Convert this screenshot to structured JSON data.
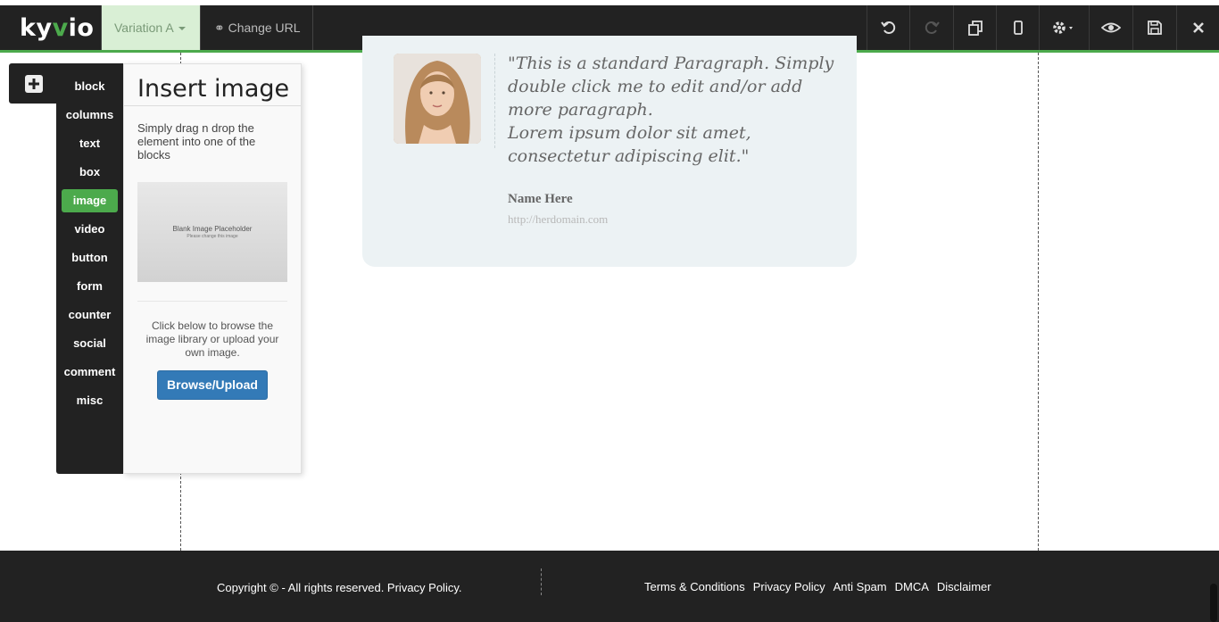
{
  "topbar": {
    "logo_text": "kyvio",
    "variation_label": "Variation A",
    "change_url_label": "Change URL",
    "actions": [
      "undo-icon",
      "redo-icon",
      "duplicate-icon",
      "mobile-preview-icon",
      "settings-icon",
      "preview-icon",
      "save-icon",
      "close-icon"
    ],
    "accent_color": "#4caa4c"
  },
  "sidebar": {
    "items": [
      {
        "label": "block"
      },
      {
        "label": "columns"
      },
      {
        "label": "text"
      },
      {
        "label": "box"
      },
      {
        "label": "image",
        "active": true
      },
      {
        "label": "video"
      },
      {
        "label": "button"
      },
      {
        "label": "form"
      },
      {
        "label": "counter"
      },
      {
        "label": "social"
      },
      {
        "label": "comment"
      },
      {
        "label": "misc"
      }
    ]
  },
  "panel": {
    "title": "Insert image",
    "description": "Simply drag n drop the element into one of the blocks",
    "placeholder_title": "Blank Image Placeholder",
    "placeholder_subtitle": "Please change this image",
    "help_text": "Click below to browse the image library or upload your own image.",
    "browse_label": "Browse/Upload"
  },
  "testimonial": {
    "quote": "\"This is a standard Paragraph. Simply double click me to edit and/or add more paragraph.\nLorem ipsum dolor sit amet, consectetur adipiscing elit.\"",
    "name": "Name Here",
    "url": "http://herdomain.com"
  },
  "footer": {
    "copyright": "Copyright © - All rights reserved. Privacy Policy.",
    "links": [
      "Terms & Conditions",
      "Privacy Policy",
      "Anti Spam",
      "DMCA",
      "Disclaimer"
    ]
  }
}
